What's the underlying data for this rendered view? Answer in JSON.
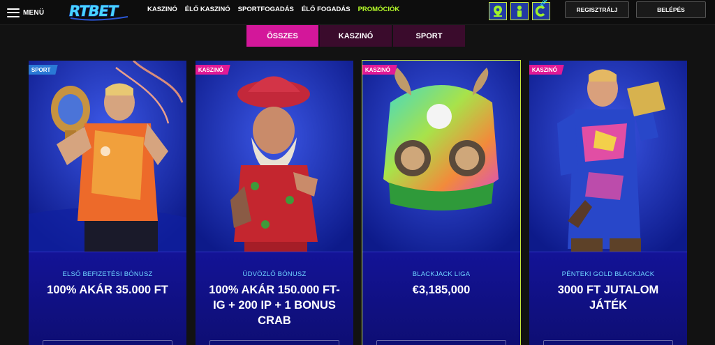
{
  "header": {
    "menu_label": "MENÜ",
    "logo_text": "RTBET",
    "nav": [
      {
        "label": "KASZINÓ"
      },
      {
        "label": "ÉLŐ KASZINÓ"
      },
      {
        "label": "SPORTFOGADÁS"
      },
      {
        "label": "ÉLŐ FOGADÁS"
      },
      {
        "label": "PROMÓCIÓK",
        "active": true
      }
    ],
    "icons": [
      "map-pin-icon",
      "person-icon",
      "free-coin-icon"
    ],
    "free_label": "FREE",
    "register_label": "REGISZTRÁLJ",
    "login_label": "BELÉPÉS"
  },
  "tabs": [
    {
      "label": "ÖSSZES",
      "active": true
    },
    {
      "label": "KASZINÓ"
    },
    {
      "label": "SPORT"
    }
  ],
  "cards": [
    {
      "category": "SPORT",
      "subtitle": "ELSŐ BEFIZETÉSI BÓNUSZ",
      "title": "100% AKÁR 35.000 FT",
      "image": "football-player-with-trophy"
    },
    {
      "category": "KASZINÓ",
      "subtitle": "ÜDVÖZLŐ BÓNUSZ",
      "title": "100% AKÁR 150.000 FT-IG + 200 IP + 1 BONUS CRAB",
      "image": "bearded-old-man-character"
    },
    {
      "category": "KASZINÓ",
      "subtitle": "BLACKJACK LIGA",
      "title": "€3,185,000",
      "image": "mega-win-helmet"
    },
    {
      "category": "KASZINÓ",
      "subtitle": "PÉNTEKI GOLD BLACKJACK",
      "title": "3000 FT JUTALOM JÁTÉK",
      "image": "man-with-gold-bar"
    }
  ],
  "colors": {
    "accent_pink": "#d3179a",
    "accent_green": "#b7ff2a",
    "card_blue": "#1b1b7a",
    "subtitle_cyan": "#6fd3ff"
  }
}
